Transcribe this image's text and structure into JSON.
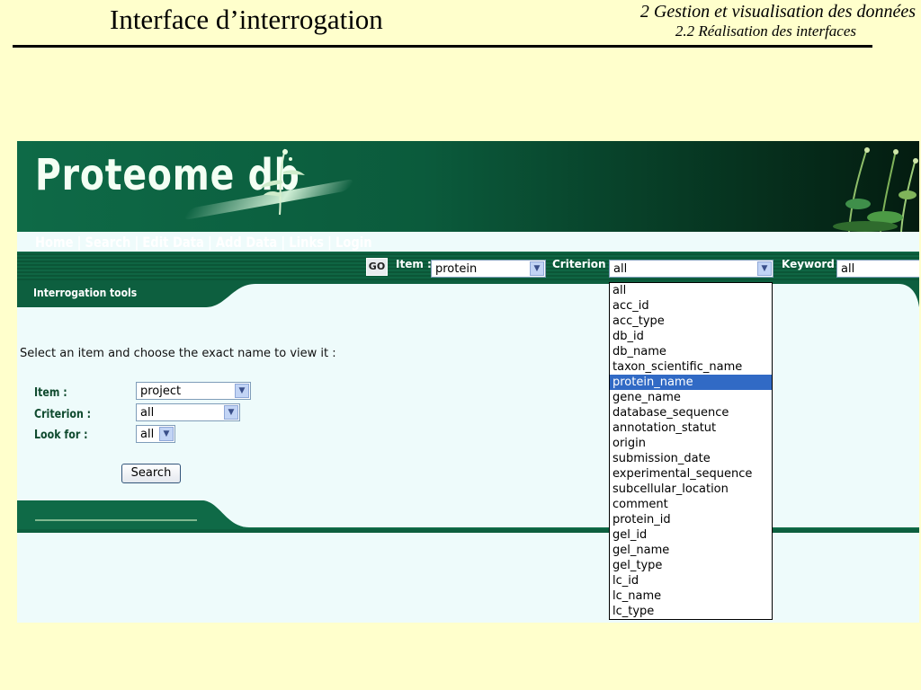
{
  "slide": {
    "title": "Interface d’interrogation",
    "section": "2 Gestion et visualisation des données",
    "subsection": "2.2 Réalisation des interfaces"
  },
  "app": {
    "logo": "Proteome db",
    "nav": [
      {
        "label": "Home"
      },
      {
        "label": "Search"
      },
      {
        "label": "Edit Data"
      },
      {
        "label": "Add Data"
      },
      {
        "label": "Links"
      },
      {
        "label": "Login"
      }
    ],
    "nav_separator": "|",
    "toolbar": {
      "go_label": "GO",
      "item_label": "Item :",
      "item_value": "protein",
      "criterion_label": "Criterion :",
      "criterion_value": "all",
      "keyword_label": "Keyword :",
      "keyword_value": "all"
    },
    "panel_title": "Interrogation tools",
    "instruction": "Select an item and choose the exact name to view it :",
    "form": {
      "item_label": "Item :",
      "item_value": "project",
      "criterion_label": "Criterion :",
      "criterion_value": "all",
      "lookfor_label": "Look for :",
      "lookfor_value": "all",
      "search_button": "Search"
    },
    "criterion_dropdown": {
      "selected": "protein_name",
      "options": [
        "all",
        "acc_id",
        "acc_type",
        "db_id",
        "db_name",
        "taxon_scientific_name",
        "protein_name",
        "gene_name",
        "database_sequence",
        "annotation_statut",
        "origin",
        "submission_date",
        "experimental_sequence",
        "subcellular_location",
        "comment",
        "protein_id",
        "gel_id",
        "gel_name",
        "gel_type",
        "lc_id",
        "lc_name",
        "lc_type"
      ]
    }
  },
  "icons": {
    "select_arrow": "chevron-down-icon"
  },
  "colors": {
    "banner_green": "#0b5b3c",
    "slide_bg": "#ffffcc",
    "highlight": "#316ac5"
  }
}
